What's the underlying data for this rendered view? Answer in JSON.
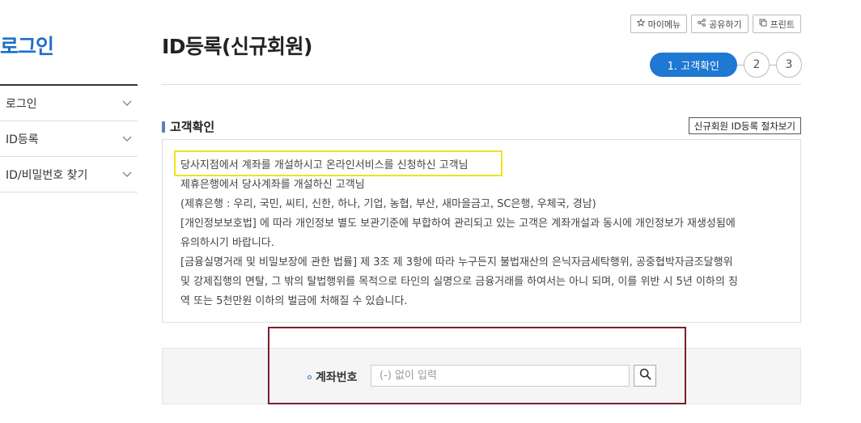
{
  "sidebar": {
    "title": "로그인",
    "items": [
      {
        "label": "로그인"
      },
      {
        "label": "ID등록"
      },
      {
        "label": "ID/비밀번호 찾기"
      }
    ]
  },
  "header": {
    "title": "ID등록(신규회원)",
    "utility": {
      "mymenu": "마이메뉴",
      "share": "공유하기",
      "print": "프린트"
    },
    "steps": {
      "active": "1. 고객확인",
      "step2": "2",
      "step3": "3"
    }
  },
  "section": {
    "title": "고객확인",
    "procedure_button": "신규회원 ID등록 절차보기",
    "lines": [
      "당사지점에서 계좌를 개설하시고 온라인서비스를 신청하신 고객님",
      "제휴은행에서 당사계좌를 개설하신 고객님",
      "(제휴은행 : 우리, 국민, 씨티, 신한, 하나, 기업, 농협, 부산, 새마을금고, SC은행, 우체국, 경남)",
      "[개인정보보호법] 에 따라 개인정보 별도 보관기준에 부합하여 관리되고 있는 고객은 계좌개설과 동시에 개인정보가 재생성됨에",
      "유의하시기 바랍니다.",
      "[금융실명거래 및 비밀보장에 관한 법률] 제 3조 제 3항에 따라 누구든지 불법재산의 은닉자금세탁행위, 공중협박자금조달행위",
      "및 강제집행의 면탈, 그 밖의 탈법행위를 목적으로 타인의 실명으로 금융거래를 하여서는 아니 되며, 이를 위반 시 5년 이하의 징",
      "역 또는 5천만원 이하의 벌금에 처해질 수 있습니다."
    ]
  },
  "account": {
    "label": "계좌번호",
    "placeholder": "(-) 없이 입력",
    "value": ""
  },
  "colors": {
    "accent": "#1f78d1",
    "highlight_border": "#f1e21f",
    "annotation_frame": "#7c1e2c"
  }
}
